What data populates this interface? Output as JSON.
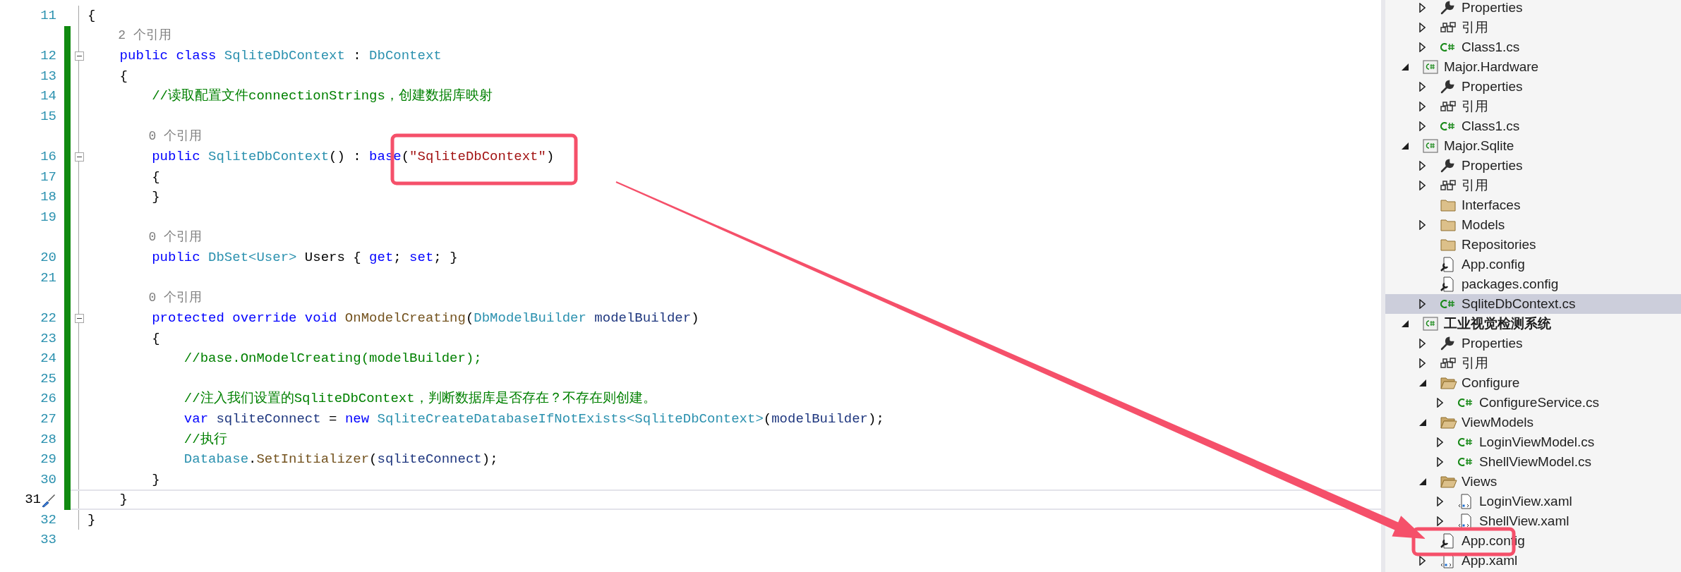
{
  "editor": {
    "rows": [
      {
        "kind": "line",
        "number": "11",
        "changed": false,
        "current": false,
        "foldable": false,
        "tokens": [
          {
            "kind": "plain",
            "text": "{"
          }
        ]
      },
      {
        "kind": "codelens",
        "changed": true,
        "text": "    2 个引用"
      },
      {
        "kind": "line",
        "number": "12",
        "changed": true,
        "current": false,
        "foldable": true,
        "tokens": [
          {
            "kind": "keyword",
            "text": "    public class "
          },
          {
            "kind": "type",
            "text": "SqliteDbContext"
          },
          {
            "kind": "plain",
            "text": " : "
          },
          {
            "kind": "type",
            "text": "DbContext"
          }
        ]
      },
      {
        "kind": "line",
        "number": "13",
        "changed": true,
        "current": false,
        "foldable": false,
        "tokens": [
          {
            "kind": "plain",
            "text": "    {"
          }
        ]
      },
      {
        "kind": "line",
        "number": "14",
        "changed": true,
        "current": false,
        "foldable": false,
        "tokens": [
          {
            "kind": "comment",
            "text": "        //读取配置文件connectionStrings，创建数据库映射"
          }
        ]
      },
      {
        "kind": "line",
        "number": "15",
        "changed": true,
        "current": false,
        "foldable": false,
        "tokens": []
      },
      {
        "kind": "codelens",
        "changed": true,
        "text": "        0 个引用"
      },
      {
        "kind": "line",
        "number": "16",
        "changed": true,
        "current": false,
        "foldable": true,
        "tokens": [
          {
            "kind": "keyword",
            "text": "        public "
          },
          {
            "kind": "type",
            "text": "SqliteDbContext"
          },
          {
            "kind": "plain",
            "text": "() : "
          },
          {
            "kind": "keyword",
            "text": "base"
          },
          {
            "kind": "plain",
            "text": "("
          },
          {
            "kind": "string",
            "text": "\"SqliteDbContext\""
          },
          {
            "kind": "plain",
            "text": ")"
          }
        ]
      },
      {
        "kind": "line",
        "number": "17",
        "changed": true,
        "current": false,
        "foldable": false,
        "tokens": [
          {
            "kind": "plain",
            "text": "        {"
          }
        ]
      },
      {
        "kind": "line",
        "number": "18",
        "changed": true,
        "current": false,
        "foldable": false,
        "tokens": [
          {
            "kind": "plain",
            "text": "        }"
          }
        ]
      },
      {
        "kind": "line",
        "number": "19",
        "changed": true,
        "current": false,
        "foldable": false,
        "tokens": []
      },
      {
        "kind": "codelens",
        "changed": true,
        "text": "        0 个引用"
      },
      {
        "kind": "line",
        "number": "20",
        "changed": true,
        "current": false,
        "foldable": false,
        "tokens": [
          {
            "kind": "keyword",
            "text": "        public "
          },
          {
            "kind": "type",
            "text": "DbSet<User>"
          },
          {
            "kind": "plain",
            "text": " Users { "
          },
          {
            "kind": "keyword",
            "text": "get"
          },
          {
            "kind": "plain",
            "text": "; "
          },
          {
            "kind": "keyword",
            "text": "set"
          },
          {
            "kind": "plain",
            "text": "; }"
          }
        ]
      },
      {
        "kind": "line",
        "number": "21",
        "changed": true,
        "current": false,
        "foldable": false,
        "tokens": []
      },
      {
        "kind": "codelens",
        "changed": true,
        "text": "        0 个引用"
      },
      {
        "kind": "line",
        "number": "22",
        "changed": true,
        "current": false,
        "foldable": true,
        "tokens": [
          {
            "kind": "keyword",
            "text": "        protected override void "
          },
          {
            "kind": "method",
            "text": "OnModelCreating"
          },
          {
            "kind": "plain",
            "text": "("
          },
          {
            "kind": "type",
            "text": "DbModelBuilder"
          },
          {
            "kind": "param",
            "text": " modelBuilder"
          },
          {
            "kind": "plain",
            "text": ")"
          }
        ]
      },
      {
        "kind": "line",
        "number": "23",
        "changed": true,
        "current": false,
        "foldable": false,
        "tokens": [
          {
            "kind": "plain",
            "text": "        {"
          }
        ]
      },
      {
        "kind": "line",
        "number": "24",
        "changed": true,
        "current": false,
        "foldable": false,
        "tokens": [
          {
            "kind": "comment",
            "text": "            //base.OnModelCreating(modelBuilder);"
          }
        ]
      },
      {
        "kind": "line",
        "number": "25",
        "changed": true,
        "current": false,
        "foldable": false,
        "tokens": []
      },
      {
        "kind": "line",
        "number": "26",
        "changed": true,
        "current": false,
        "foldable": false,
        "tokens": [
          {
            "kind": "comment",
            "text": "            //注入我们设置的SqliteDbContext，判断数据库是否存在？不存在则创建。"
          }
        ]
      },
      {
        "kind": "line",
        "number": "27",
        "changed": true,
        "current": false,
        "foldable": false,
        "tokens": [
          {
            "kind": "keyword",
            "text": "            var"
          },
          {
            "kind": "param",
            "text": " sqliteConnect"
          },
          {
            "kind": "plain",
            "text": " = "
          },
          {
            "kind": "keyword",
            "text": "new "
          },
          {
            "kind": "type",
            "text": "SqliteCreateDatabaseIfNotExists<SqliteDbContext>"
          },
          {
            "kind": "plain",
            "text": "("
          },
          {
            "kind": "param",
            "text": "modelBuilder"
          },
          {
            "kind": "plain",
            "text": ");"
          }
        ]
      },
      {
        "kind": "line",
        "number": "28",
        "changed": true,
        "current": false,
        "foldable": false,
        "tokens": [
          {
            "kind": "comment",
            "text": "            //执行"
          }
        ]
      },
      {
        "kind": "line",
        "number": "29",
        "changed": true,
        "current": false,
        "foldable": false,
        "tokens": [
          {
            "kind": "type",
            "text": "            Database"
          },
          {
            "kind": "plain",
            "text": "."
          },
          {
            "kind": "method",
            "text": "SetInitializer"
          },
          {
            "kind": "plain",
            "text": "("
          },
          {
            "kind": "param",
            "text": "sqliteConnect"
          },
          {
            "kind": "plain",
            "text": ");"
          }
        ]
      },
      {
        "kind": "line",
        "number": "30",
        "changed": true,
        "current": false,
        "foldable": false,
        "tokens": [
          {
            "kind": "plain",
            "text": "        }"
          }
        ]
      },
      {
        "kind": "line",
        "number": "31",
        "changed": true,
        "current": true,
        "foldable": false,
        "tokens": [
          {
            "kind": "plain",
            "text": "    }"
          }
        ]
      },
      {
        "kind": "line",
        "number": "32",
        "changed": false,
        "current": false,
        "foldable": false,
        "tokens": [
          {
            "kind": "plain",
            "text": "}"
          }
        ]
      },
      {
        "kind": "line",
        "number": "33",
        "changed": false,
        "current": false,
        "foldable": false,
        "tokens": []
      }
    ]
  },
  "solution_explorer": {
    "leading_items": [
      {
        "label": "Properties",
        "kind": "properties",
        "expanded": false,
        "selected": false
      },
      {
        "label": "引用",
        "kind": "references",
        "expanded": false,
        "selected": false
      },
      {
        "label": "Class1.cs",
        "kind": "csharp",
        "expanded": false,
        "selected": false
      }
    ],
    "projects": [
      {
        "label": "Major.Hardware",
        "kind": "project",
        "startup": false,
        "expanded": true,
        "selected": false,
        "children": [
          {
            "label": "Properties",
            "kind": "properties",
            "expanded": false,
            "selected": false
          },
          {
            "label": "引用",
            "kind": "references",
            "expanded": false,
            "selected": false
          },
          {
            "label": "Class1.cs",
            "kind": "csharp",
            "expanded": false,
            "selected": false
          }
        ]
      },
      {
        "label": "Major.Sqlite",
        "kind": "project",
        "startup": false,
        "expanded": true,
        "selected": false,
        "children": [
          {
            "label": "Properties",
            "kind": "properties",
            "expanded": false,
            "selected": false
          },
          {
            "label": "引用",
            "kind": "references",
            "expanded": false,
            "selected": false
          },
          {
            "label": "Interfaces",
            "kind": "folder",
            "selected": false
          },
          {
            "label": "Models",
            "kind": "folder",
            "expanded": false,
            "selected": false
          },
          {
            "label": "Repositories",
            "kind": "folder",
            "selected": false
          },
          {
            "label": "App.config",
            "kind": "config",
            "selected": false
          },
          {
            "label": "packages.config",
            "kind": "config",
            "selected": false
          },
          {
            "label": "SqliteDbContext.cs",
            "kind": "csharp",
            "expanded": false,
            "selected": true
          }
        ]
      },
      {
        "label": "工业视觉检测系统",
        "kind": "project",
        "startup": true,
        "expanded": true,
        "selected": false,
        "children": [
          {
            "label": "Properties",
            "kind": "properties",
            "expanded": false,
            "selected": false
          },
          {
            "label": "引用",
            "kind": "references",
            "expanded": false,
            "selected": false
          },
          {
            "label": "Configure",
            "kind": "folder",
            "expanded": true,
            "selected": false,
            "children": [
              {
                "label": "ConfigureService.cs",
                "kind": "csharp",
                "expanded": false,
                "selected": false
              }
            ]
          },
          {
            "label": "ViewModels",
            "kind": "folder",
            "expanded": true,
            "selected": false,
            "children": [
              {
                "label": "LoginViewModel.cs",
                "kind": "csharp",
                "expanded": false,
                "selected": false
              },
              {
                "label": "ShellViewModel.cs",
                "kind": "csharp",
                "expanded": false,
                "selected": false
              }
            ]
          },
          {
            "label": "Views",
            "kind": "folder",
            "expanded": true,
            "selected": false,
            "children": [
              {
                "label": "LoginView.xaml",
                "kind": "xaml",
                "expanded": false,
                "selected": false
              },
              {
                "label": "ShellView.xaml",
                "kind": "xaml",
                "expanded": false,
                "selected": false
              }
            ]
          },
          {
            "label": "App.config",
            "kind": "config",
            "selected": false
          },
          {
            "label": "App.xaml",
            "kind": "xaml",
            "expanded": false,
            "selected": false
          }
        ]
      }
    ]
  }
}
